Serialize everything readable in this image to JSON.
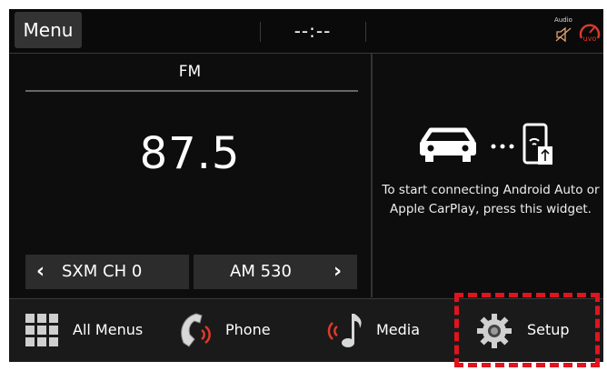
{
  "topbar": {
    "menu_label": "Menu",
    "clock": "--:--",
    "audio_status": "Audio",
    "audio_icon": "speaker-muted-icon",
    "uvo_icon": "uvo-icon"
  },
  "radio": {
    "band": "FM",
    "frequency": "87.5",
    "prev_preset": "SXM CH 0",
    "next_preset": "AM 530"
  },
  "widget": {
    "message": "To start connecting Android Auto or Apple CarPlay, press this widget.",
    "icons": [
      "car-icon",
      "phone-usb-icon"
    ]
  },
  "dock": {
    "items": [
      {
        "label": "All Menus",
        "icon": "grid-icon"
      },
      {
        "label": "Phone",
        "icon": "phone-icon"
      },
      {
        "label": "Media",
        "icon": "music-note-icon"
      },
      {
        "label": "Setup",
        "icon": "gear-icon"
      }
    ]
  },
  "colors": {
    "highlight": "#e0141e",
    "accent_red": "#e03a2a"
  }
}
